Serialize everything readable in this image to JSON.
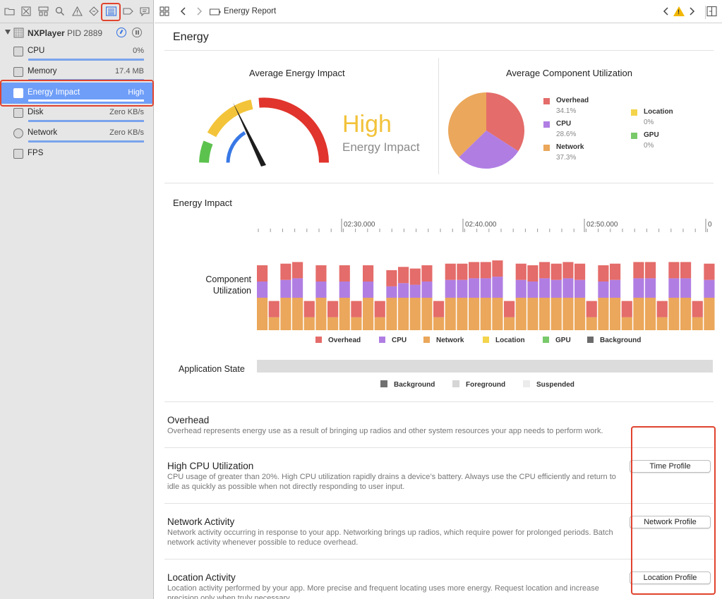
{
  "navigator": {
    "process_name": "NXPlayer",
    "process_pid": "PID 2889",
    "gauges": [
      {
        "label": "CPU",
        "value": "0%"
      },
      {
        "label": "Memory",
        "value": "17.4 MB"
      },
      {
        "label": "Energy Impact",
        "value": "High"
      },
      {
        "label": "Disk",
        "value": "Zero KB/s"
      },
      {
        "label": "Network",
        "value": "Zero KB/s"
      },
      {
        "label": "FPS",
        "value": ""
      }
    ]
  },
  "jumpbar": {
    "title": "Energy Report"
  },
  "report": {
    "heading": "Energy",
    "avg_energy_title": "Average Energy Impact",
    "impact_level": "High",
    "impact_caption": "Energy Impact",
    "avg_component_title": "Average Component Utilization",
    "pie_legend": [
      {
        "name": "Overhead",
        "pct": "34.1%",
        "color": "#e46c6a"
      },
      {
        "name": "CPU",
        "pct": "28.6%",
        "color": "#b07ee3"
      },
      {
        "name": "Network",
        "pct": "37.3%",
        "color": "#eba75b"
      },
      {
        "name": "Location",
        "pct": "0%",
        "color": "#f3d44b"
      },
      {
        "name": "GPU",
        "pct": "0%",
        "color": "#78c96a"
      }
    ],
    "energy_impact_title": "Energy Impact",
    "timeline_ticks": [
      "02:30.000",
      "02:40.000",
      "02:50.000",
      "0"
    ],
    "component_label_1": "Component",
    "component_label_2": "Utilization",
    "bar_legend": [
      {
        "name": "Overhead",
        "color": "#e46c6a"
      },
      {
        "name": "CPU",
        "color": "#b07ee3"
      },
      {
        "name": "Network",
        "color": "#eba75b"
      },
      {
        "name": "Location",
        "color": "#f3d44b"
      },
      {
        "name": "GPU",
        "color": "#78c96a"
      },
      {
        "name": "Background",
        "color": "#6b6b6b"
      }
    ],
    "app_state_label": "Application State",
    "state_legend": [
      {
        "name": "Background",
        "color": "#707070"
      },
      {
        "name": "Foreground",
        "color": "#d6d6d6"
      },
      {
        "name": "Suspended",
        "color": "#ececec"
      }
    ],
    "sections": [
      {
        "title": "Overhead",
        "desc": "Overhead represents energy use as a result of bringing up radios and other system resources your app needs to perform work.",
        "button": ""
      },
      {
        "title": "High CPU Utilization",
        "desc": "CPU usage of greater than 20%. High CPU utilization rapidly drains a device’s battery. Always use the CPU efficiently and return to idle as quickly as possible when not directly responding to user input.",
        "button": "Time Profile"
      },
      {
        "title": "Network Activity",
        "desc": "Network activity occurring in response to your app. Networking brings up radios, which require power for prolonged periods. Batch network activity whenever possible to reduce overhead.",
        "button": "Network Profile"
      },
      {
        "title": "Location Activity",
        "desc": "Location activity performed by your app. More precise and frequent locating uses more energy. Request location and increase precision only when truly necessary.",
        "button": "Location Profile"
      }
    ]
  },
  "chart_data": [
    {
      "type": "pie",
      "title": "Average Component Utilization",
      "categories": [
        "Overhead",
        "CPU",
        "Network",
        "Location",
        "GPU"
      ],
      "values": [
        34.1,
        28.6,
        37.3,
        0,
        0
      ]
    },
    {
      "type": "bar",
      "title": "Energy Impact",
      "ylabel": "Component Utilization",
      "x": [
        "02:30.000",
        "02:40.000",
        "02:50.000"
      ],
      "series": [
        {
          "name": "Network",
          "values": [
            1,
            0.4,
            1,
            1,
            0.4,
            1,
            0.4,
            1,
            0.4,
            1,
            0.4,
            1,
            1,
            1,
            1,
            0.4,
            1,
            1,
            1,
            1,
            1,
            0.4,
            1,
            1,
            1,
            1,
            1,
            1,
            0.4,
            1,
            1,
            0.4,
            1,
            1,
            0.4,
            1,
            1,
            0.4,
            1
          ]
        },
        {
          "name": "CPU",
          "values": [
            0.5,
            0,
            0.55,
            0.6,
            0,
            0.5,
            0,
            0.5,
            0,
            0.5,
            0,
            0.35,
            0.45,
            0.4,
            0.5,
            0,
            0.55,
            0.55,
            0.6,
            0.6,
            0.65,
            0,
            0.55,
            0.5,
            0.6,
            0.55,
            0.6,
            0.55,
            0,
            0.5,
            0.55,
            0,
            0.6,
            0.6,
            0,
            0.6,
            0.6,
            0,
            0.55
          ]
        },
        {
          "name": "Overhead",
          "values": [
            0.5,
            0.5,
            0.5,
            0.5,
            0.5,
            0.5,
            0.5,
            0.5,
            0.5,
            0.5,
            0.5,
            0.5,
            0.5,
            0.5,
            0.5,
            0.5,
            0.5,
            0.5,
            0.5,
            0.5,
            0.5,
            0.5,
            0.5,
            0.5,
            0.5,
            0.5,
            0.5,
            0.5,
            0.5,
            0.5,
            0.5,
            0.5,
            0.5,
            0.5,
            0.5,
            0.5,
            0.5,
            0.5,
            0.5
          ]
        }
      ]
    }
  ]
}
